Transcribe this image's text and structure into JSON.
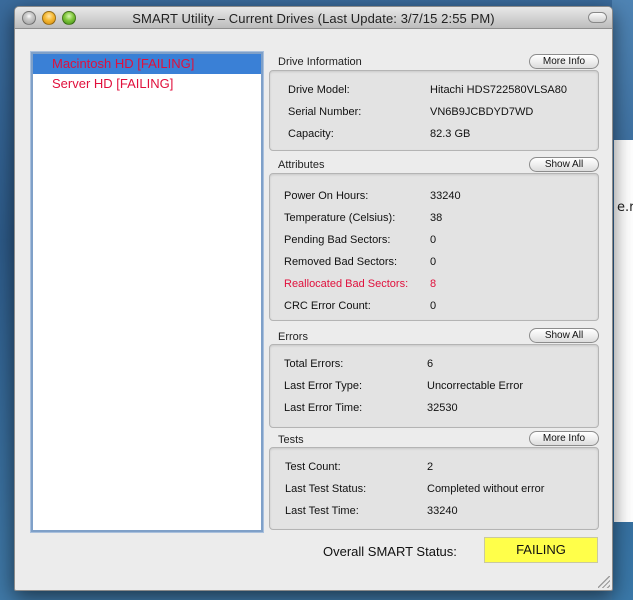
{
  "window": {
    "title": "SMART Utility – Current Drives (Last Update: 3/7/15 2:55 PM)"
  },
  "background": {
    "partial_text": "e.r"
  },
  "drives": [
    {
      "label": "Macintosh HD  [FAILING]",
      "selected": true
    },
    {
      "label": "Server HD  [FAILING]",
      "selected": false
    }
  ],
  "drive_info": {
    "heading": "Drive Information",
    "button": "More Info",
    "rows": [
      {
        "label": "Drive Model:",
        "value": "Hitachi HDS722580VLSA80"
      },
      {
        "label": "Serial Number:",
        "value": "VN6B9JCBDYD7WD"
      },
      {
        "label": "Capacity:",
        "value": "82.3 GB"
      }
    ]
  },
  "attributes": {
    "heading": "Attributes",
    "button": "Show All",
    "rows": [
      {
        "label": "Power On Hours:",
        "value": "33240",
        "alert": false
      },
      {
        "label": "Temperature (Celsius):",
        "value": "38",
        "alert": false
      },
      {
        "label": "Pending Bad Sectors:",
        "value": "0",
        "alert": false
      },
      {
        "label": "Removed Bad Sectors:",
        "value": "0",
        "alert": false
      },
      {
        "label": "Reallocated Bad Sectors:",
        "value": "8",
        "alert": true
      },
      {
        "label": "CRC Error Count:",
        "value": "0",
        "alert": false
      }
    ]
  },
  "errors": {
    "heading": "Errors",
    "button": "Show All",
    "rows": [
      {
        "label": "Total Errors:",
        "value": "6"
      },
      {
        "label": "Last Error Type:",
        "value": "Uncorrectable Error"
      },
      {
        "label": "Last Error Time:",
        "value": "32530"
      }
    ]
  },
  "tests": {
    "heading": "Tests",
    "button": "More Info",
    "rows": [
      {
        "label": "Test Count:",
        "value": "2"
      },
      {
        "label": "Last Test Status:",
        "value": "Completed without error"
      },
      {
        "label": "Last Test Time:",
        "value": "33240"
      }
    ]
  },
  "overall": {
    "label": "Overall SMART Status:",
    "value": "FAILING"
  },
  "colors": {
    "failing_text": "#e0103c",
    "selection": "#3a80d6",
    "status_highlight": "#ffff4a"
  }
}
